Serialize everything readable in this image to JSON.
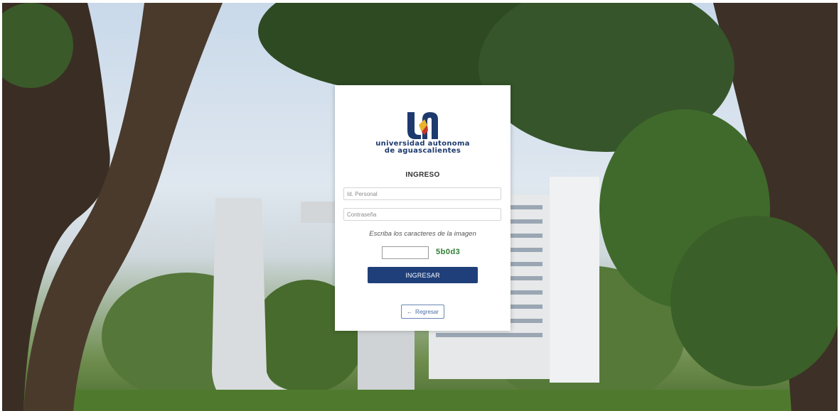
{
  "logo": {
    "line1": "universidad autonoma",
    "line2": "de aguascalientes"
  },
  "form": {
    "heading": "INGRESO",
    "id_placeholder": "Id. Personal",
    "password_placeholder": "Contraseña",
    "captcha_prompt": "Escriba los caracteres de la imagen",
    "captcha_code": "5b0d3",
    "submit_label": "INGRESAR",
    "back_label": "Regresar",
    "back_arrow": "←"
  },
  "colors": {
    "brand_blue": "#1f3f7a",
    "captcha_green": "#2e7d32",
    "logo_gold": "#e8b52a",
    "logo_red": "#c8342c"
  }
}
